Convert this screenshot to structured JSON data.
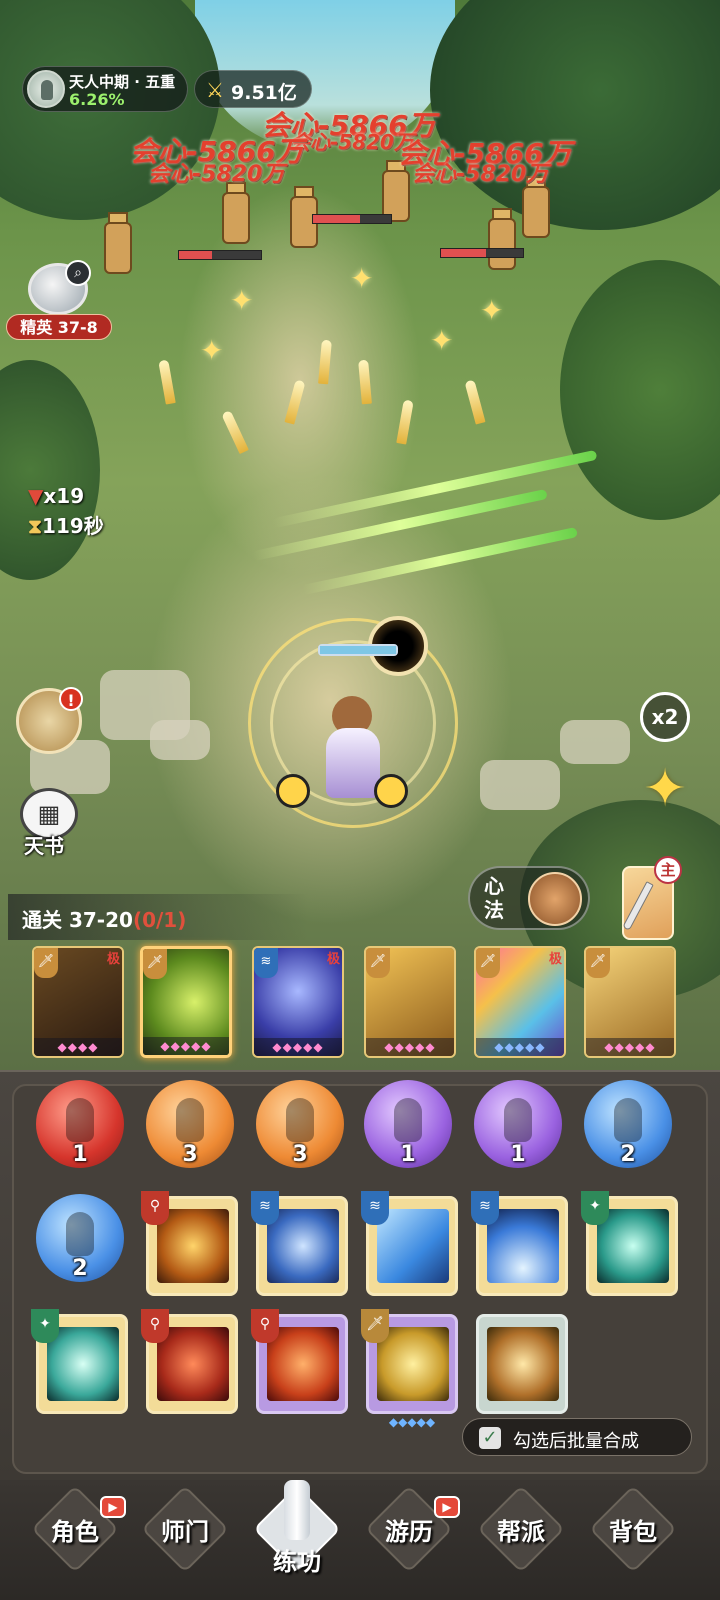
{
  "hud": {
    "realm_name": "天人中期 · 五重",
    "realm_progress": "6.26%",
    "power_value": "9.51亿",
    "stage_tag": "精英 37-8",
    "kill_count": "x19",
    "time_left": "119秒",
    "notification_mark": "!",
    "tianshu_label": "天书",
    "speed_label": "x2",
    "xinfa_label": "心法",
    "weapon_main_label": "主",
    "clear_label": "通关 37-20",
    "clear_progress": "(0/1)"
  },
  "damage_numbers": [
    "会心-5866万",
    "会心-5820万",
    "会心-5866万",
    "会心-5820万",
    "会心-5866万",
    "会心-5820万"
  ],
  "skill_cards": [
    {
      "type_icon": "sword",
      "rank": "极",
      "stars": 4,
      "selected": false
    },
    {
      "type_icon": "sword",
      "rank": "",
      "stars": 5,
      "selected": true
    },
    {
      "type_icon": "wave",
      "rank": "极",
      "stars": 5,
      "selected": false
    },
    {
      "type_icon": "sword",
      "rank": "",
      "stars": 5,
      "selected": false
    },
    {
      "type_icon": "sword",
      "rank": "极",
      "stars": 5,
      "selected": false
    },
    {
      "type_icon": "sword",
      "rank": "",
      "stars": 5,
      "selected": false
    }
  ],
  "inventory": {
    "gems": [
      {
        "color": "red",
        "count": "1"
      },
      {
        "color": "orange",
        "count": "3"
      },
      {
        "color": "orange",
        "count": "3"
      },
      {
        "color": "purple",
        "count": "1"
      },
      {
        "color": "purple",
        "count": "1"
      },
      {
        "color": "blue",
        "count": "2"
      },
      {
        "color": "blue",
        "count": "2"
      }
    ],
    "batch_label": "勾选后批量合成",
    "batch_checked": true
  },
  "nav": {
    "items": [
      {
        "label": "角色",
        "badge": true
      },
      {
        "label": "师门",
        "badge": false
      },
      {
        "label": "练功",
        "badge": false
      },
      {
        "label": "游历",
        "badge": true
      },
      {
        "label": "帮派",
        "badge": false
      },
      {
        "label": "背包",
        "badge": false
      }
    ],
    "active_index": 2
  },
  "colors": {
    "damage_red": "#e4402e",
    "progress_green": "#9cf06d",
    "elite_red": "#b12a22",
    "clear_progress_red": "#e0503c"
  }
}
